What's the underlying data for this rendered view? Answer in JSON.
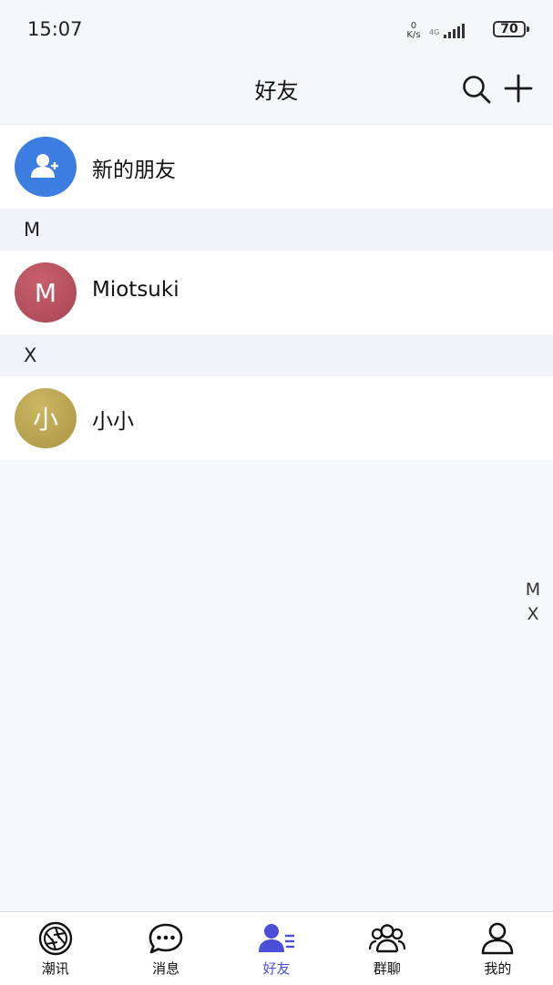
{
  "status_bar": {
    "time": "15:07",
    "net_speed_value": "0",
    "net_speed_unit": "K/s",
    "battery": "70"
  },
  "header": {
    "title": "好友"
  },
  "new_friends": {
    "label": "新的朋友",
    "icon": "add-user-icon",
    "color": "#3b7de0"
  },
  "sections": [
    {
      "letter": "M",
      "contacts": [
        {
          "name": "Miotsuki",
          "avatar_text": "M",
          "avatar_color": "#b4505c"
        }
      ]
    },
    {
      "letter": "X",
      "contacts": [
        {
          "name": "小小",
          "avatar_text": "小",
          "avatar_color": "#b9a54e"
        }
      ]
    }
  ],
  "index_bar": [
    "M",
    "X"
  ],
  "bottom_nav": {
    "items": [
      {
        "label": "潮讯",
        "icon": "camera-aperture-icon",
        "active": false
      },
      {
        "label": "消息",
        "icon": "chat-bubble-icon",
        "active": false
      },
      {
        "label": "好友",
        "icon": "contacts-icon",
        "active": true
      },
      {
        "label": "群聊",
        "icon": "group-icon",
        "active": false
      },
      {
        "label": "我的",
        "icon": "person-icon",
        "active": false
      }
    ],
    "active_color": "#4a4ed8"
  }
}
